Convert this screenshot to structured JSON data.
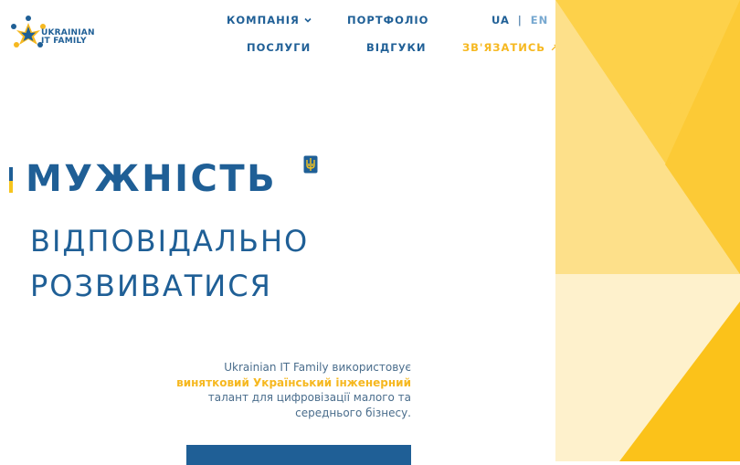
{
  "brand": {
    "name_line1": "UKRAINIAN",
    "name_line2": "IT FAMILY",
    "logo_icon": "star-people-logo-icon"
  },
  "nav": {
    "company": "КОМПАНІЯ",
    "portfolio": "ПОРТФОЛІО",
    "services": "ПОСЛУГИ",
    "reviews": "ВІДГУКИ",
    "contact": "ЗВ'ЯЗАТИСЬ",
    "contact_icon": "arrow-up-right-icon",
    "company_icon": "chevron-down-icon"
  },
  "lang": {
    "ua": "UA",
    "separator": "|",
    "en": "EN",
    "active": "UA"
  },
  "hero": {
    "word": "МУЖНІСТЬ",
    "line2": "ВІДПОВІДАЛЬНО",
    "line3": "РОЗВИВАТИСЯ",
    "emblem_icon": "trident-icon"
  },
  "description": {
    "part1": "Ukrainian IT Family використовує",
    "highlight": "винятковий Український інженерний",
    "part2": "талант для цифровізації малого та середнього бізнесу."
  },
  "colors": {
    "primary": "#1f5f96",
    "accent": "#f6b820",
    "yellow_light": "#fde08a",
    "yellow_pale": "#fef1cc",
    "yellow_mid": "#fdd14a",
    "yellow_strong": "#fbc21a"
  }
}
